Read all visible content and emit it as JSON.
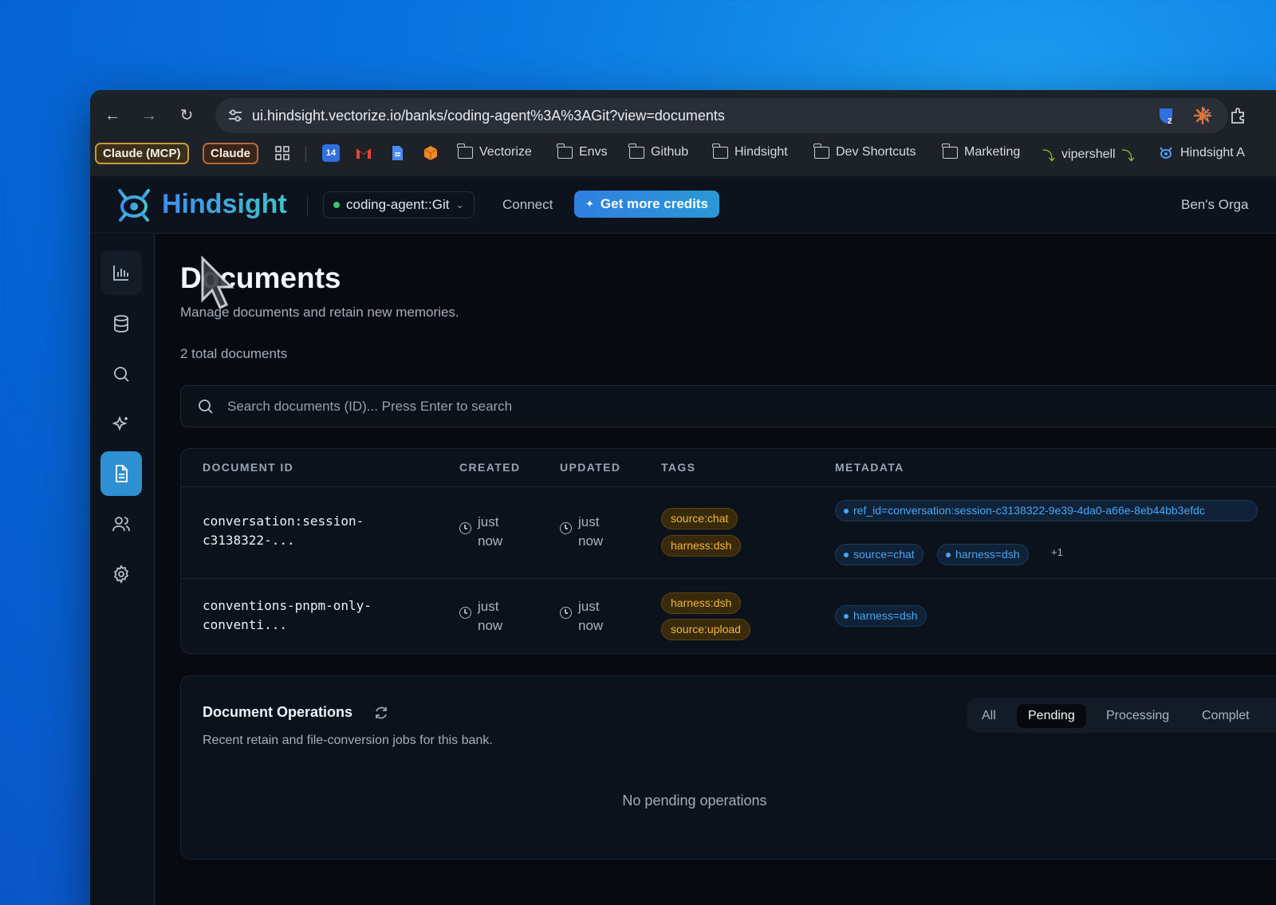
{
  "browser": {
    "url": "ui.hindsight.vectorize.io/banks/coding-agent%3A%3AGit?view=documents",
    "extension_badge": "2",
    "bookmarks": {
      "pill_mcp": "Claude (MCP)",
      "pill_claude": "Claude",
      "calendar_day": "14",
      "folders": [
        "Vectorize",
        "Envs",
        "Github",
        "Hindsight",
        "Dev Shortcuts",
        "Marketing"
      ],
      "vipershell": "vipershell",
      "hindsight_app": "Hindsight A"
    }
  },
  "app": {
    "logo_text": "Hindsight",
    "bank_selector": "coding-agent::Git",
    "connect_label": "Connect",
    "credits_label": "Get more credits",
    "org_label": "Ben's Orga"
  },
  "page": {
    "title": "Documents",
    "subtitle": "Manage documents and retain new memories.",
    "total": "2 total documents",
    "search_placeholder": "Search documents (ID)... Press Enter to search"
  },
  "table": {
    "headers": {
      "id": "DOCUMENT ID",
      "created": "CREATED",
      "updated": "UPDATED",
      "tags": "TAGS",
      "metadata": "METADATA"
    },
    "rows": [
      {
        "id_line1": "conversation:session-",
        "id_line2": "c3138322-...",
        "created_1": "just",
        "created_2": "now",
        "updated_1": "just",
        "updated_2": "now",
        "tags": [
          "source:chat",
          "harness:dsh"
        ],
        "metadata": [
          "ref_id=conversation:session-c3138322-9e39-4da0-a66e-8eb44bb3efdc",
          "source=chat",
          "harness=dsh"
        ],
        "more": "+1"
      },
      {
        "id_line1": "conventions-pnpm-only-",
        "id_line2": "conventi...",
        "created_1": "just",
        "created_2": "now",
        "updated_1": "just",
        "updated_2": "now",
        "tags": [
          "harness:dsh",
          "source:upload"
        ],
        "metadata": [
          "harness=dsh"
        ]
      }
    ]
  },
  "operations": {
    "title": "Document Operations",
    "subtitle": "Recent retain and file-conversion jobs for this bank.",
    "tabs": [
      "All",
      "Pending",
      "Processing",
      "Complet"
    ],
    "active_tab": "Pending",
    "empty_message": "No pending operations"
  },
  "colors": {
    "accent": "#2e8fd2",
    "tag_text": "#f0b73c",
    "meta_text": "#4aa6f0",
    "status_dot": "#3fc276"
  }
}
